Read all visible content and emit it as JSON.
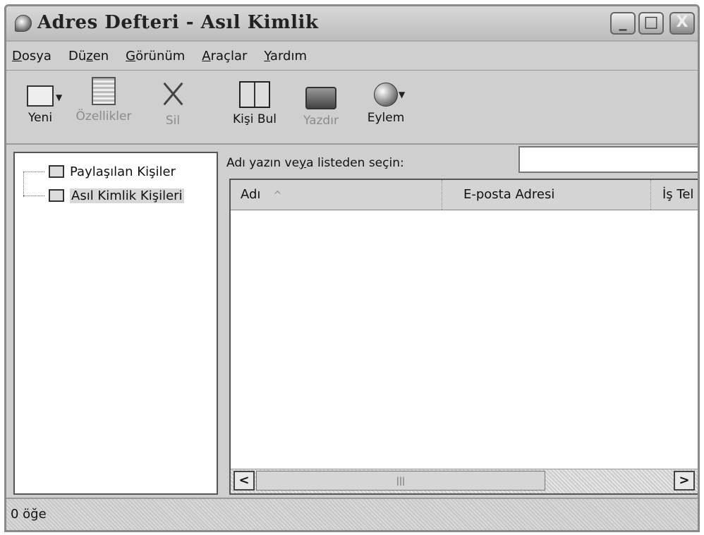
{
  "window": {
    "title": "Adres Defteri - Asıl Kimlik",
    "buttons": {
      "minimize": "_",
      "maximize": "□",
      "close": "X"
    }
  },
  "menu": {
    "items": [
      {
        "accel": "D",
        "rest": "osya"
      },
      {
        "accel": "",
        "pre": "Dü",
        "accel2": "z",
        "rest": "en"
      },
      {
        "accel": "G",
        "rest": "örünüm"
      },
      {
        "accel": "A",
        "rest": "raçlar"
      },
      {
        "accel": "Y",
        "rest": "ardım"
      }
    ]
  },
  "toolbar": {
    "new": "Yeni",
    "properties": "Özellikler",
    "delete": "Sil",
    "find_people": "Kişi Bul",
    "print": "Yazdır",
    "action": "Eylem"
  },
  "tree": {
    "items": [
      {
        "label": "Paylaşılan Kişiler",
        "icon": "shared-contacts-icon"
      },
      {
        "label": "Asıl Kimlik Kişileri",
        "icon": "folder-icon"
      }
    ]
  },
  "search": {
    "label_pre": "Adı yazın ve",
    "label_accel": "y",
    "label_post": "a listeden seçin:",
    "value": ""
  },
  "list": {
    "columns": {
      "name": "Adı",
      "sort_indicator": "^",
      "email": "E-posta Adresi",
      "phone": "İş Tel"
    },
    "scroll": {
      "left": "<",
      "right": ">",
      "grip": "|||"
    }
  },
  "status": {
    "text": "0 öğe"
  }
}
